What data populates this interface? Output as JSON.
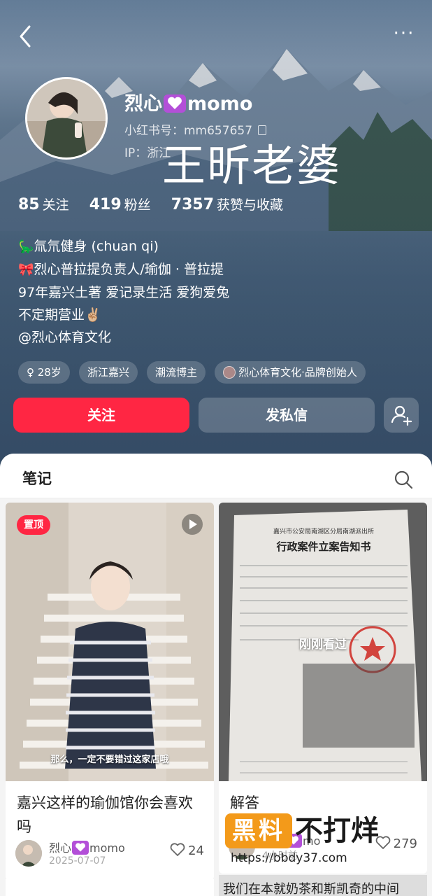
{
  "header": {
    "back_label": "‹",
    "more_label": "···"
  },
  "profile": {
    "name_prefix": "烈心",
    "name_suffix": "momo",
    "xhs_id": "小红书号：mm657657",
    "ip": "IP：浙江",
    "overlay_text": "王昕老婆"
  },
  "stats": [
    {
      "num": "85",
      "label": "关注"
    },
    {
      "num": "419",
      "label": "粉丝"
    },
    {
      "num": "7357",
      "label": "获赞与收藏"
    }
  ],
  "bio": [
    {
      "icon": "🦕",
      "text": "氚氘健身 (chuan qi)"
    },
    {
      "icon": "🎀",
      "text": "烈心普拉提负责人/瑜伽 · 普拉提"
    },
    {
      "icon": "",
      "text": "97年嘉兴土著 爱记录生活 爱狗爱兔"
    },
    {
      "icon": "",
      "text": "不定期营业✌🏼"
    },
    {
      "icon": "",
      "text": "@烈心体育文化"
    }
  ],
  "tags": {
    "age": "♀ 28岁",
    "location": "浙江嘉兴",
    "category": "潮流博主",
    "brand": "烈心体育文化·品牌创始人"
  },
  "actions": {
    "follow": "关注",
    "message": "发私信"
  },
  "tabs": {
    "notes": "笔记"
  },
  "notes": [
    {
      "pinned": "置顶",
      "caption": "那么，一定不要错过这家店哦",
      "title": "嘉兴这样的瑜伽馆你会喜欢吗",
      "author_prefix": "烈心",
      "author_suffix": "momo",
      "date": "2025-07-07",
      "likes": "24"
    },
    {
      "seen": "刚刚看过",
      "doc_title": "行政案件立案告知书",
      "title": "解答",
      "author_prefix": "烈心",
      "author_suffix": "mo",
      "date": "4小时前",
      "likes": "279"
    }
  ],
  "watermark": {
    "box": "黑料",
    "text": "不打烊",
    "url": "https://bbdy37.com"
  },
  "next_note": {
    "title": "我们在本就奶茶和斯凯奇的中间"
  },
  "colors": {
    "accent": "#ff2643",
    "heart_badge": "#b34fd8",
    "watermark": "#f39a1a"
  }
}
